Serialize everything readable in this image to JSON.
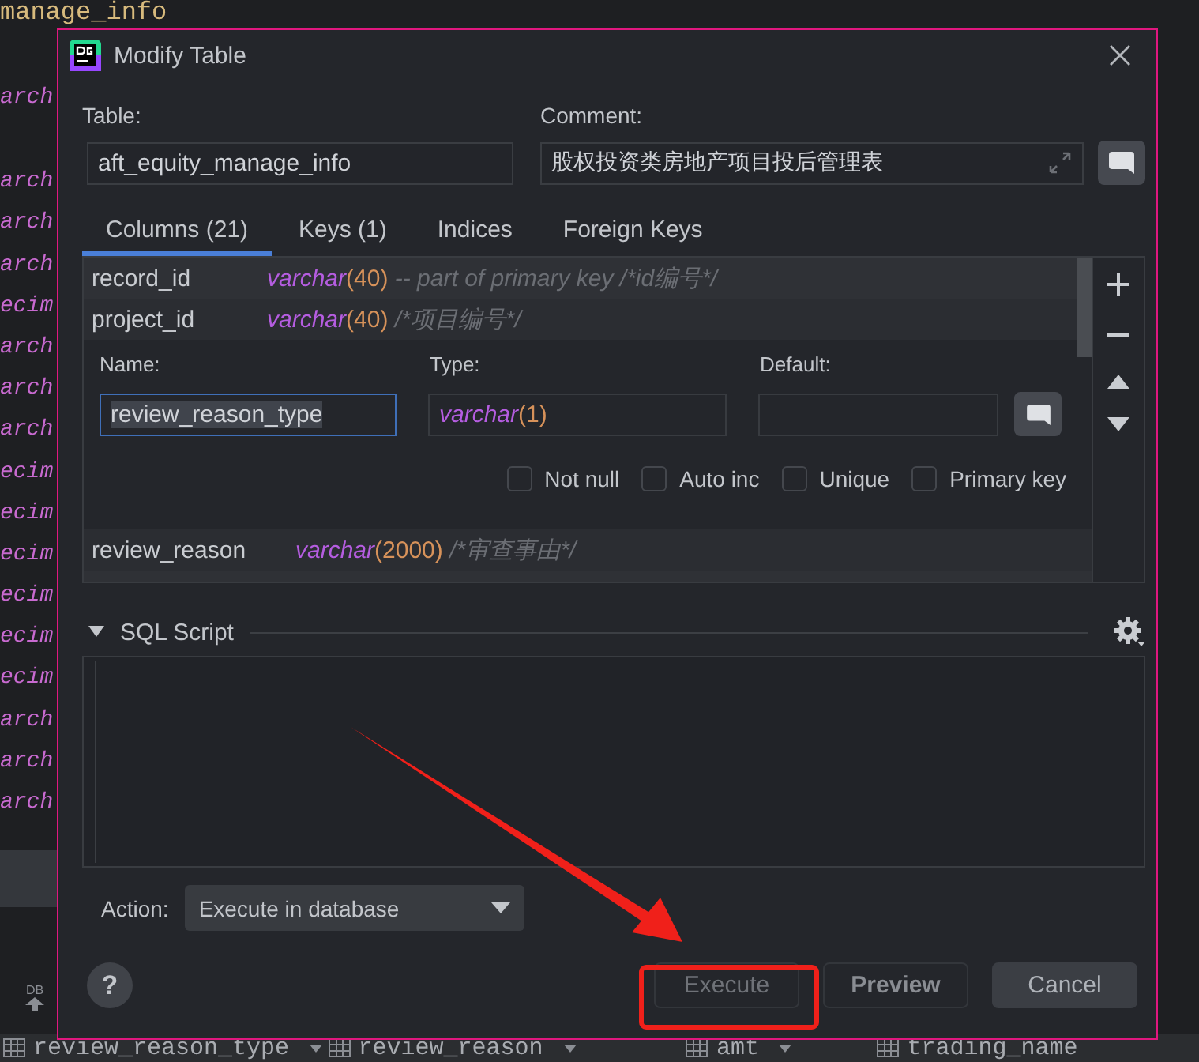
{
  "editor_background": {
    "code_lines": [
      {
        "text": "manage_info",
        "kind": "name"
      },
      {
        "text": "arch",
        "kind": "type"
      },
      {
        "text": "arch",
        "kind": "type"
      },
      {
        "text": "arch",
        "kind": "type"
      },
      {
        "text": "arch",
        "kind": "type"
      },
      {
        "text": "ecim",
        "kind": "type"
      },
      {
        "text": "arch",
        "kind": "type"
      },
      {
        "text": "arch",
        "kind": "type"
      },
      {
        "text": "arch",
        "kind": "type"
      },
      {
        "text": "ecim",
        "kind": "type"
      },
      {
        "text": "ecim",
        "kind": "type"
      },
      {
        "text": "ecim",
        "kind": "type"
      },
      {
        "text": "ecim",
        "kind": "type"
      },
      {
        "text": "ecim",
        "kind": "type"
      },
      {
        "text": "ecim",
        "kind": "type"
      },
      {
        "text": "arch",
        "kind": "type"
      },
      {
        "text": "arch",
        "kind": "type"
      },
      {
        "text": "arch",
        "kind": "type"
      }
    ],
    "side_label": "DB",
    "bottom_tabs": [
      "review_reason_type",
      "review_reason",
      "amt",
      "trading_name"
    ]
  },
  "dialog": {
    "title": "Modify Table",
    "table_label": "Table:",
    "table_name": "aft_equity_manage_info",
    "comment_label": "Comment:",
    "comment": "股权投资类房地产项目投后管理表",
    "tabs": [
      {
        "label": "Columns (21)",
        "selected": true
      },
      {
        "label": "Keys (1)",
        "selected": false
      },
      {
        "label": "Indices",
        "selected": false
      },
      {
        "label": "Foreign Keys",
        "selected": false
      }
    ],
    "columns": [
      {
        "kind": "row",
        "name": "record_id",
        "type": "varchar",
        "args": "(40)",
        "comment": "-- part of primary key /*id编号*/"
      },
      {
        "kind": "row",
        "name": "project_id",
        "type": "varchar",
        "args": "(40)",
        "comment": "/*项目编号*/"
      },
      {
        "kind": "editor",
        "name_label": "Name:",
        "name": "review_reason_type",
        "type_label": "Type:",
        "type": "varchar",
        "args": "(1)",
        "default_label": "Default:",
        "options": [
          {
            "label": "Not null",
            "checked": false
          },
          {
            "label": "Auto inc",
            "checked": false
          },
          {
            "label": "Unique",
            "checked": false
          },
          {
            "label": "Primary key",
            "checked": false
          }
        ]
      },
      {
        "kind": "row",
        "name": "review_reason",
        "type": "varchar",
        "args": "(2000)",
        "comment": "/*审查事由*/"
      }
    ],
    "sql_section": {
      "title": "SQL Script",
      "expanded": true
    },
    "help_label": "?",
    "action_label": "Action:",
    "action": "Execute in database",
    "buttons": [
      {
        "label": "Execute",
        "kind": "disabled"
      },
      {
        "label": "Preview",
        "kind": "bold"
      },
      {
        "label": "Cancel",
        "kind": "default"
      }
    ]
  }
}
